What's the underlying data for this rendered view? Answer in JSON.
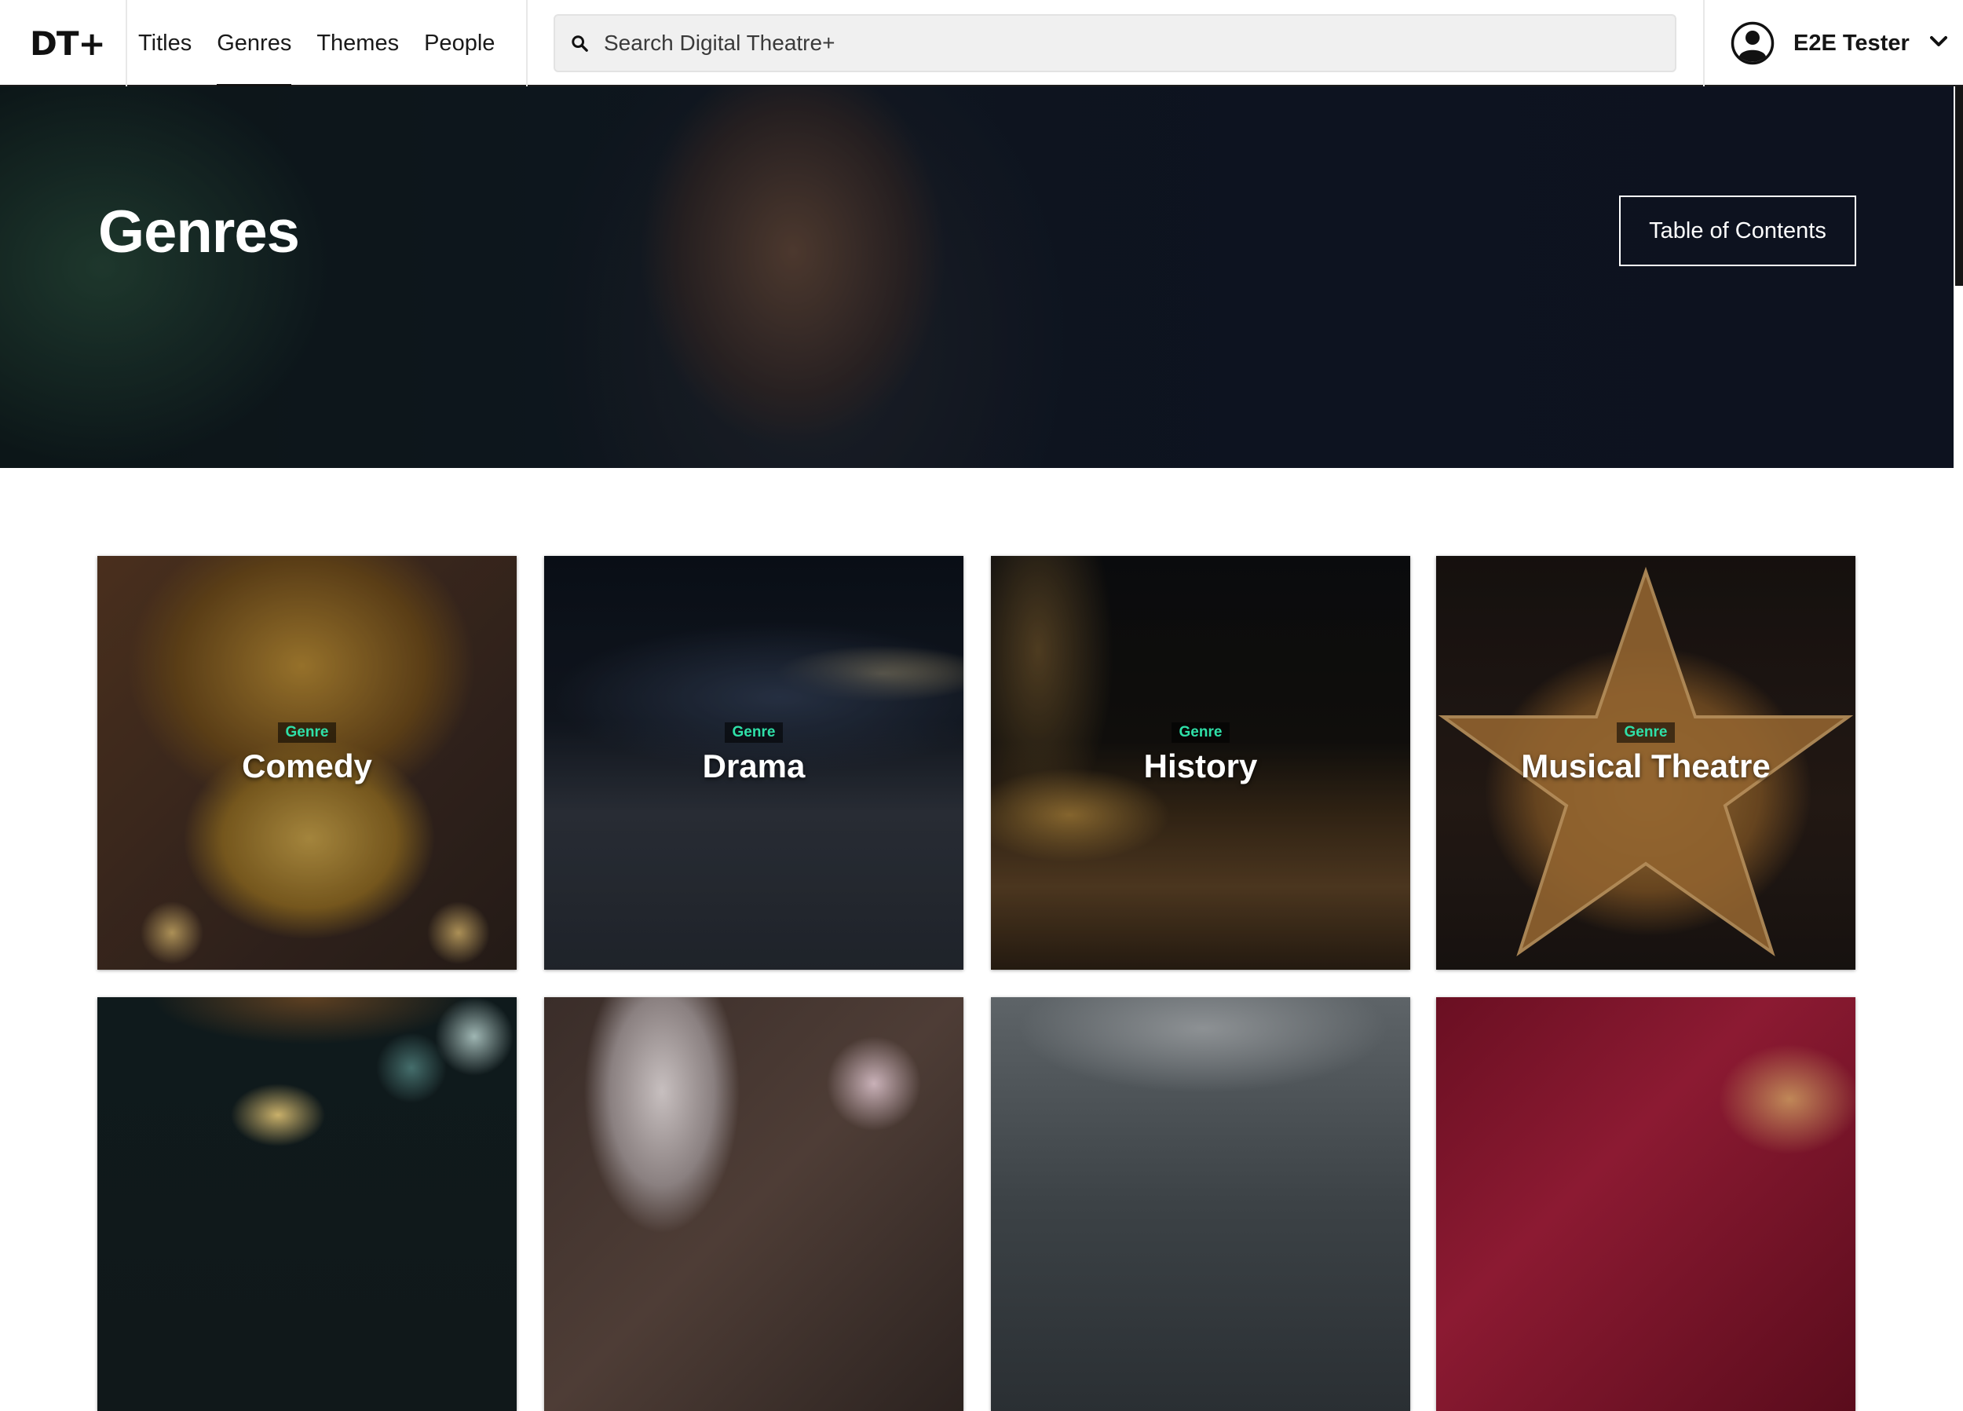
{
  "header": {
    "logo": "DT+",
    "nav": [
      {
        "label": "Titles",
        "active": false
      },
      {
        "label": "Genres",
        "active": true
      },
      {
        "label": "Themes",
        "active": false
      },
      {
        "label": "People",
        "active": false
      }
    ],
    "search": {
      "placeholder": "Search Digital Theatre+",
      "value": ""
    },
    "user": {
      "name": "E2E Tester"
    }
  },
  "hero": {
    "title": "Genres",
    "toc_label": "Table of Contents"
  },
  "cards": [
    {
      "tag": "Genre",
      "name": "Comedy"
    },
    {
      "tag": "Genre",
      "name": "Drama"
    },
    {
      "tag": "Genre",
      "name": "History"
    },
    {
      "tag": "Genre",
      "name": "Musical Theatre"
    },
    {
      "tag": "",
      "name": ""
    },
    {
      "tag": "",
      "name": ""
    },
    {
      "tag": "",
      "name": ""
    },
    {
      "tag": "",
      "name": ""
    }
  ],
  "colors": {
    "genre_tag": "#2fe0a8",
    "header_border": "#1b1b1b",
    "search_bg": "#f0f0f0"
  }
}
